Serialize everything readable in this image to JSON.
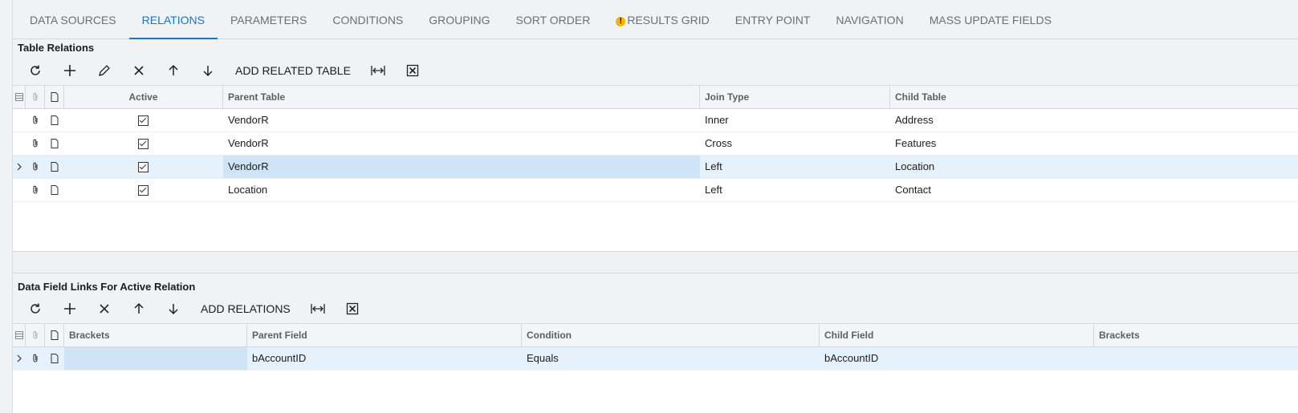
{
  "tabs": [
    {
      "label": "DATA SOURCES",
      "active": false,
      "warning": false
    },
    {
      "label": "RELATIONS",
      "active": true,
      "warning": false
    },
    {
      "label": "PARAMETERS",
      "active": false,
      "warning": false
    },
    {
      "label": "CONDITIONS",
      "active": false,
      "warning": false
    },
    {
      "label": "GROUPING",
      "active": false,
      "warning": false
    },
    {
      "label": "SORT ORDER",
      "active": false,
      "warning": false
    },
    {
      "label": "RESULTS GRID",
      "active": false,
      "warning": true
    },
    {
      "label": "ENTRY POINT",
      "active": false,
      "warning": false
    },
    {
      "label": "NAVIGATION",
      "active": false,
      "warning": false
    },
    {
      "label": "MASS UPDATE FIELDS",
      "active": false,
      "warning": false
    }
  ],
  "relations": {
    "title": "Table Relations",
    "toolbar": {
      "add_related_table_label": "ADD RELATED TABLE"
    },
    "columns": {
      "active": "Active",
      "parent_table": "Parent Table",
      "join_type": "Join Type",
      "child_table": "Child Table"
    },
    "rows": [
      {
        "active": true,
        "parent_table": "VendorR",
        "join_type": "Inner",
        "child_table": "Address",
        "selected": false
      },
      {
        "active": true,
        "parent_table": "VendorR",
        "join_type": "Cross",
        "child_table": "Features",
        "selected": false
      },
      {
        "active": true,
        "parent_table": "VendorR",
        "join_type": "Left",
        "child_table": "Location",
        "selected": true
      },
      {
        "active": true,
        "parent_table": "Location",
        "join_type": "Left",
        "child_table": "Contact",
        "selected": false
      }
    ]
  },
  "links": {
    "title": "Data Field Links For Active Relation",
    "toolbar": {
      "add_relations_label": "ADD RELATIONS"
    },
    "columns": {
      "brackets_open": "Brackets",
      "parent_field": "Parent Field",
      "condition": "Condition",
      "child_field": "Child Field",
      "brackets_close": "Brackets"
    },
    "rows": [
      {
        "brackets_open": "",
        "parent_field": "bAccountID",
        "condition": "Equals",
        "child_field": "bAccountID",
        "brackets_close": "",
        "selected": true
      }
    ]
  },
  "colors": {
    "accent": "#0f7ac6",
    "selected_row": "#e5f1fb",
    "focused_cell": "#cfe4f6",
    "warning": "#f4b400"
  },
  "icons": [
    "refresh-icon",
    "add-icon",
    "edit-icon",
    "delete-icon",
    "arrow-up-icon",
    "arrow-down-icon",
    "fit-columns-icon",
    "export-excel-icon",
    "attachment-icon",
    "note-icon",
    "row-selector-icon",
    "row-pointer-icon"
  ]
}
